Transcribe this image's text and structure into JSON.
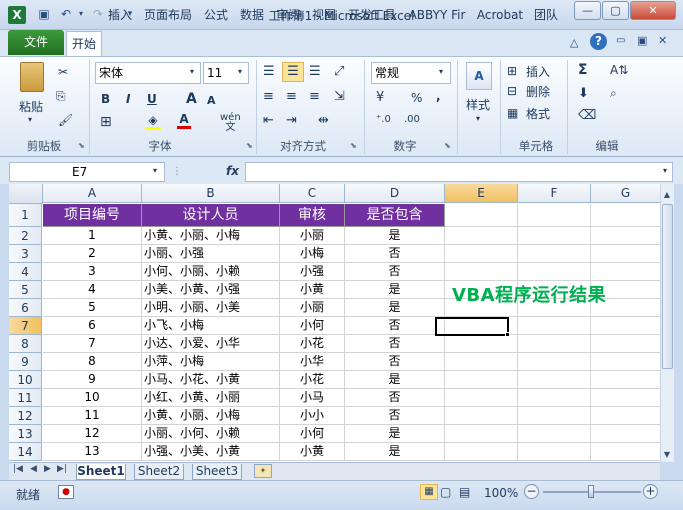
{
  "window": {
    "title": "工作簿1 - Microsoft Excel"
  },
  "tabs": {
    "file": "文件",
    "items": [
      "开始",
      "插入",
      "页面布局",
      "公式",
      "数据",
      "审阅",
      "视图",
      "开发工具",
      "ABBYY Fir",
      "Acrobat",
      "团队"
    ]
  },
  "ribbon": {
    "clipboard": {
      "label": "剪贴板",
      "paste": "粘贴"
    },
    "font": {
      "label": "字体",
      "name": "宋体",
      "size": "11",
      "bold": "B",
      "italic": "I",
      "underline": "U",
      "grow": "A",
      "shrink": "A",
      "wen": "wén\n文"
    },
    "alignment": {
      "label": "对齐方式"
    },
    "number": {
      "label": "数字",
      "format": "常规",
      "percent": "%",
      "comma": ","
    },
    "styles": {
      "label": "样式"
    },
    "cells": {
      "label": "单元格",
      "insert": "插入",
      "delete": "删除",
      "format": "格式"
    },
    "editing": {
      "label": "编辑",
      "sum": "Σ"
    }
  },
  "formula_bar": {
    "name_box": "E7",
    "fx": "fx",
    "value": ""
  },
  "columns": [
    "A",
    "B",
    "C",
    "D",
    "E",
    "F",
    "G"
  ],
  "row_numbers": [
    "1",
    "2",
    "3",
    "4",
    "5",
    "6",
    "7",
    "8",
    "9",
    "10",
    "11",
    "12",
    "13",
    "14"
  ],
  "headers": [
    "项目编号",
    "设计人员",
    "审核",
    "是否包含"
  ],
  "rows": [
    [
      "1",
      "小黄、小丽、小梅",
      "小丽",
      "是"
    ],
    [
      "2",
      "小丽、小强",
      "小梅",
      "否"
    ],
    [
      "3",
      "小何、小丽、小赖",
      "小强",
      "否"
    ],
    [
      "4",
      "小美、小黄、小强",
      "小黄",
      "是"
    ],
    [
      "5",
      "小明、小丽、小美",
      "小丽",
      "是"
    ],
    [
      "6",
      "小飞、小梅",
      "小何",
      "否"
    ],
    [
      "7",
      "小达、小爱、小华",
      "小花",
      "否"
    ],
    [
      "8",
      "小萍、小梅",
      "小华",
      "否"
    ],
    [
      "9",
      "小马、小花、小黄",
      "小花",
      "是"
    ],
    [
      "10",
      "小红、小黄、小丽",
      "小马",
      "否"
    ],
    [
      "11",
      "小黄、小丽、小梅",
      "小小",
      "否"
    ],
    [
      "12",
      "小丽、小何、小赖",
      "小何",
      "是"
    ],
    [
      "13",
      "小强、小美、小黄",
      "小黄",
      "是"
    ]
  ],
  "annotation": "VBA程序运行结果",
  "sheets": [
    "Sheet1",
    "Sheet2",
    "Sheet3"
  ],
  "status": {
    "ready": "就绪",
    "zoom": "100%"
  },
  "colors": {
    "header_fill": "#7030a0",
    "annotation": "#00b050",
    "file_tab": "#2e8b2e"
  }
}
